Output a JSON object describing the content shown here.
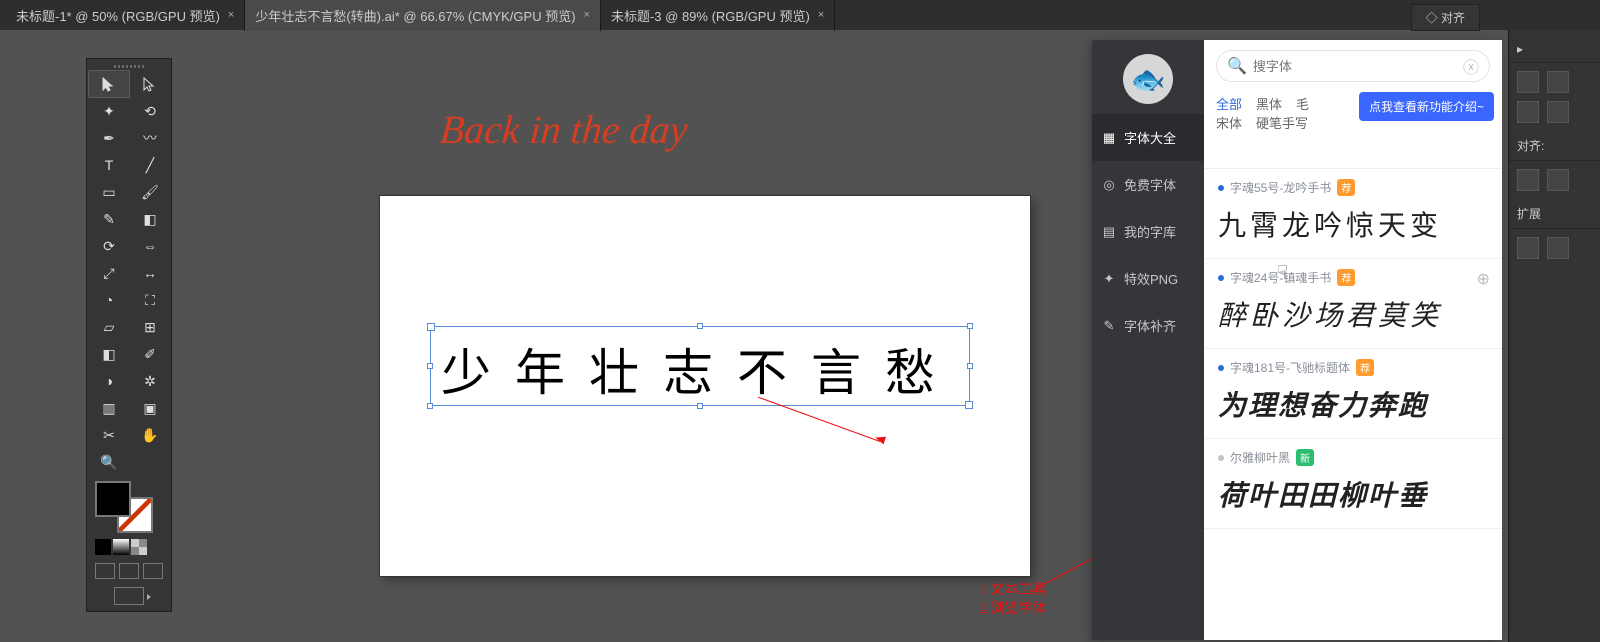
{
  "doc_tabs": [
    {
      "label": "未标题-1* @ 50% (RGB/GPU 预览)",
      "active": false
    },
    {
      "label": "少年壮志不言愁(转曲).ai* @ 66.67% (CMYK/GPU 预览)",
      "active": true
    },
    {
      "label": "未标题-3 @ 89% (RGB/GPU 预览)",
      "active": false
    }
  ],
  "canvas": {
    "script_title": "Back in the day",
    "main_text": "少年壮志不言愁"
  },
  "annotations": {
    "line1": "1 文本工具",
    "line2": "2 浏览字体"
  },
  "right_dark": {
    "top_tab": "◇ 对齐",
    "align_label": "对齐:",
    "expand_label": "扩展"
  },
  "font_panel": {
    "search_placeholder": "搜字体",
    "categories_row1": [
      "全部",
      "黑体",
      "毛"
    ],
    "categories_row2": [
      "宋体",
      "硬笔手写"
    ],
    "tip": "点我查看新功能介绍~",
    "nav": [
      {
        "label": "字体大全",
        "active": true,
        "icon": "grid"
      },
      {
        "label": "免费字体",
        "active": false,
        "icon": "coin"
      },
      {
        "label": "我的字库",
        "active": false,
        "icon": "lib"
      },
      {
        "label": "特效PNG",
        "active": false,
        "icon": "fx"
      },
      {
        "label": "字体补齐",
        "active": false,
        "icon": "pen"
      }
    ],
    "items": [
      {
        "name": "字魂55号-龙吟手书",
        "preview": "九霄龙吟惊天变",
        "style": "pv-script",
        "badge": "荐",
        "dot": "blue",
        "plus": false
      },
      {
        "name": "字魂24号-镇魂手书",
        "preview": "醉卧沙场君莫笑",
        "style": "pv-kaiti",
        "badge": "荐",
        "dot": "blue",
        "plus": true
      },
      {
        "name": "字魂181号-飞驰标题体",
        "preview": "为理想奋力奔跑",
        "style": "pv-bold",
        "badge": "荐",
        "dot": "blue",
        "plus": false
      },
      {
        "name": "尔雅柳叶黑",
        "preview": "荷叶田田柳叶垂",
        "style": "pv-black",
        "badge": "新",
        "dot": "gray",
        "plus": false,
        "green": true
      }
    ]
  }
}
